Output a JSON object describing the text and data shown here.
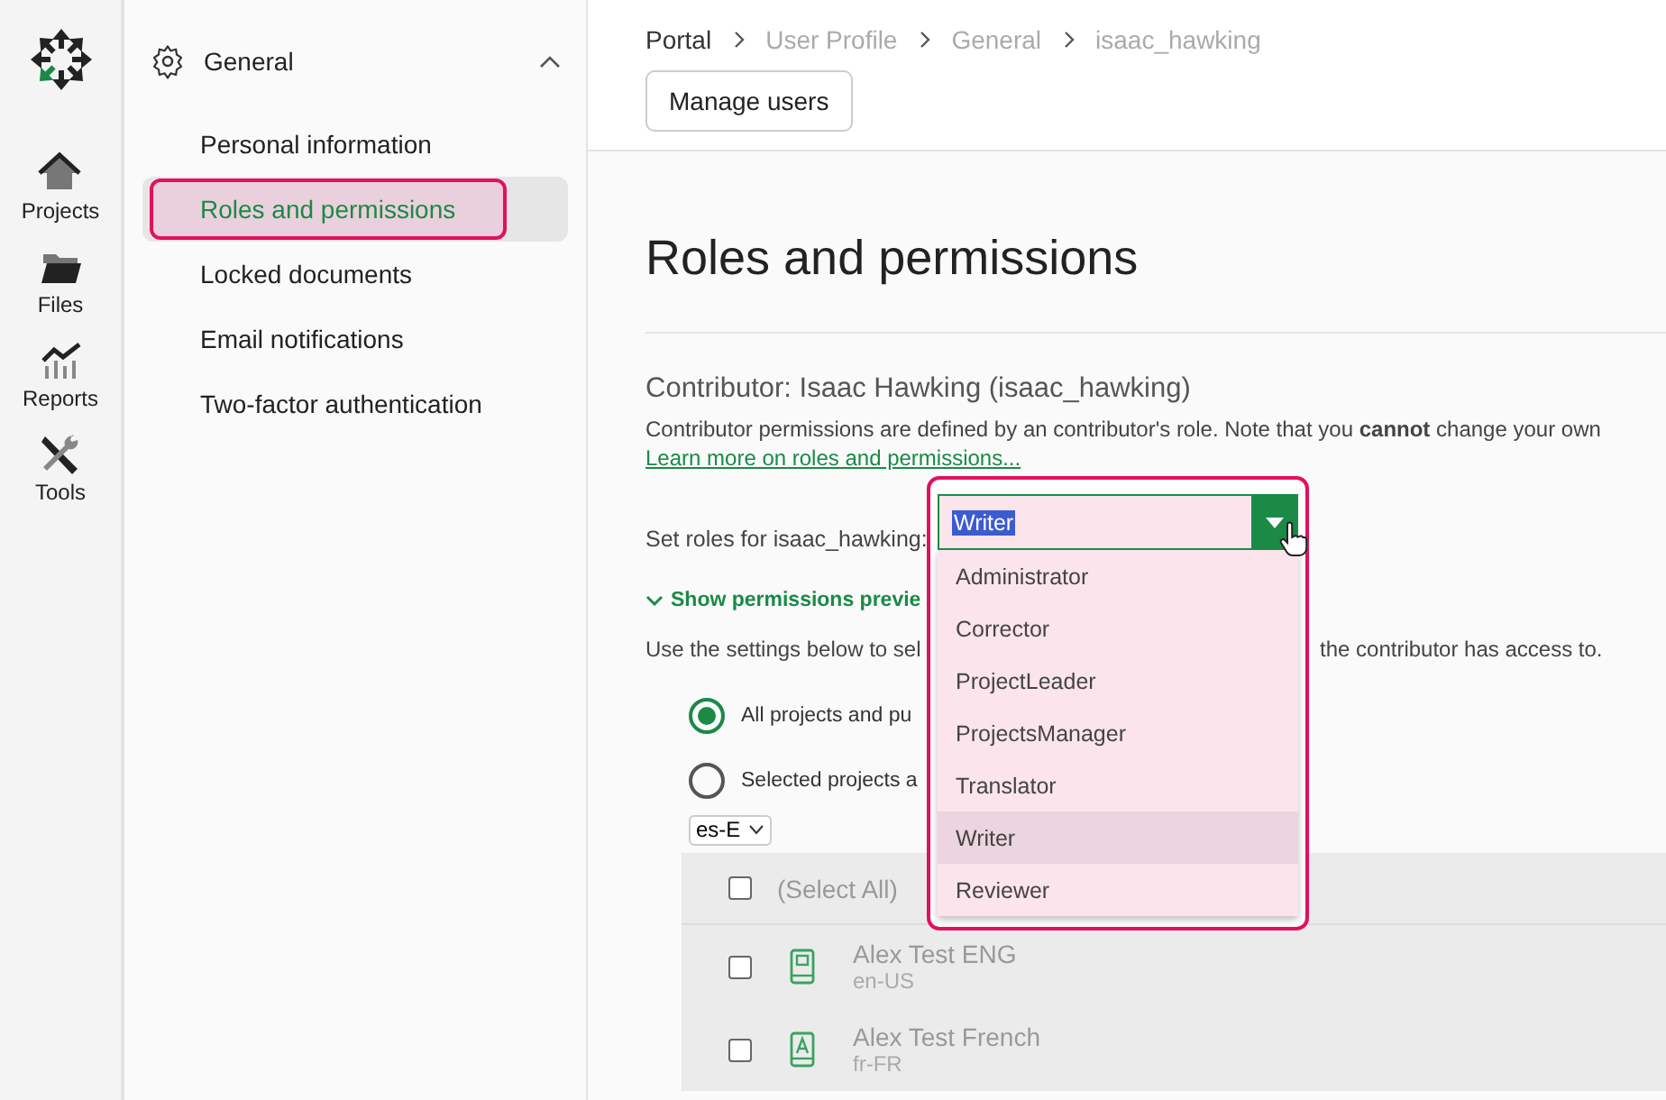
{
  "rail": {
    "items": [
      {
        "label": "Projects"
      },
      {
        "label": "Files"
      },
      {
        "label": "Reports"
      },
      {
        "label": "Tools"
      }
    ]
  },
  "nav": {
    "group": "General",
    "expanded": true,
    "items": [
      {
        "label": "Personal information",
        "selected": false
      },
      {
        "label": "Roles and permissions",
        "selected": true
      },
      {
        "label": "Locked documents",
        "selected": false
      },
      {
        "label": "Email notifications",
        "selected": false
      },
      {
        "label": "Two-factor authentication",
        "selected": false
      }
    ]
  },
  "breadcrumb": [
    "Portal",
    "User Profile",
    "General",
    "isaac_hawking"
  ],
  "header_button": "Manage users",
  "title": "Roles and permissions",
  "subtitle": "Contributor: Isaac Hawking (isaac_hawking)",
  "description": "Contributor permissions are defined by an contributor's role. Note that you **cannot** change your own",
  "link": "Learn more on roles and permissions...",
  "role_label": "Set roles for isaac_hawking:",
  "role_select": {
    "value": "Writer",
    "expanded": true,
    "options": [
      {
        "label": "Administrator",
        "selected": false
      },
      {
        "label": "Corrector",
        "selected": false
      },
      {
        "label": "ProjectLeader",
        "selected": false
      },
      {
        "label": "ProjectsManager",
        "selected": false
      },
      {
        "label": "Translator",
        "selected": false
      },
      {
        "label": "Writer",
        "selected": true
      },
      {
        "label": "Reviewer",
        "selected": false
      }
    ]
  },
  "permissions_toggle": {
    "label": "Show permissions previe",
    "expanded": false
  },
  "settings_text": [
    "Use the settings below to sel",
    "the contributor has access to."
  ],
  "scope": [
    {
      "label": "All projects and pu",
      "selected": true
    },
    {
      "label": "Selected projects a",
      "selected": false
    }
  ],
  "language_filter": "es-E",
  "table": {
    "select_all": {
      "label": "(Select All)",
      "checked": false
    },
    "rows": [
      {
        "name": "Alex Test ENG",
        "locale": "en-US",
        "checked": false
      },
      {
        "name": "Alex Test French",
        "locale": "fr-FR",
        "checked": false
      }
    ]
  }
}
